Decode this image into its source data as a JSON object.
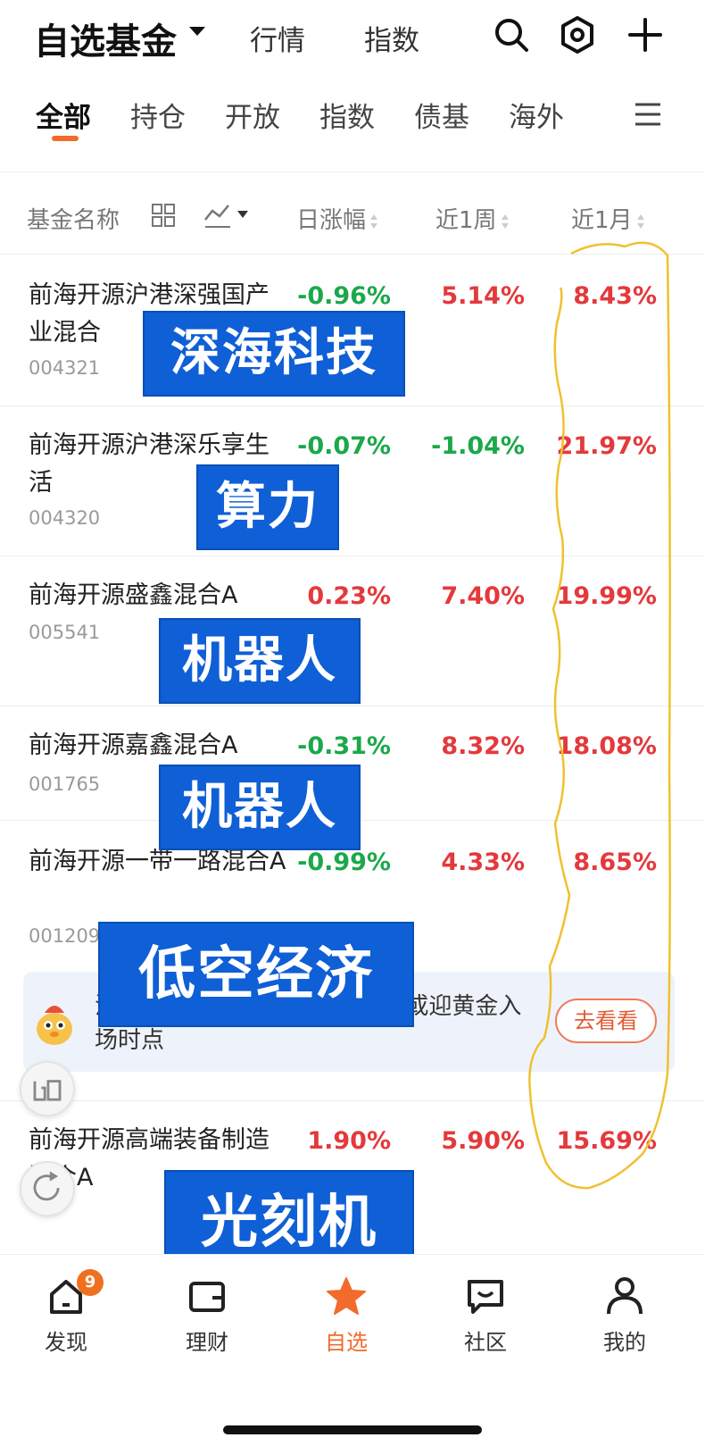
{
  "header": {
    "title": "自选基金",
    "links": [
      "行情",
      "指数"
    ]
  },
  "categories": [
    "全部",
    "持仓",
    "开放",
    "指数",
    "债基",
    "海外"
  ],
  "columns": {
    "name": "基金名称",
    "day": "日涨幅",
    "week": "近1周",
    "month": "近1月"
  },
  "funds": [
    {
      "name": "前海开源沪港深强国产业混合",
      "code": "004321",
      "day": "-0.96%",
      "week": "5.14%",
      "month": "8.43%"
    },
    {
      "name": "前海开源沪港深乐享生活",
      "code": "004320",
      "day": "-0.07%",
      "week": "-1.04%",
      "month": "21.97%"
    },
    {
      "name": "前海开源盛鑫混合A",
      "code": "005541",
      "day": "0.23%",
      "week": "7.40%",
      "month": "19.99%"
    },
    {
      "name": "前海开源嘉鑫混合A",
      "code": "001765",
      "day": "-0.31%",
      "week": "8.32%",
      "month": "18.08%"
    },
    {
      "name": "前海开源一带一路混合A",
      "code": "001209",
      "day": "-0.99%",
      "week": "4.33%",
      "month": "8.65%"
    },
    {
      "name": "前海开源高端装备制造混合A",
      "code": "",
      "day": "1.90%",
      "week": "5.90%",
      "month": "15.69%"
    }
  ],
  "overlays": [
    "深海科技",
    "算力",
    "机器人",
    "机器人",
    "低空经济",
    "光刻机"
  ],
  "promo": {
    "text_line1": "洼                                       或迎黄金入",
    "text_line2": "场时点",
    "button": "去看看"
  },
  "bottom_nav": {
    "items": [
      {
        "label": "发现",
        "icon": "home-icon",
        "badge": "9"
      },
      {
        "label": "理财",
        "icon": "wallet-icon"
      },
      {
        "label": "自选",
        "icon": "star-icon"
      },
      {
        "label": "社区",
        "icon": "chat-icon"
      },
      {
        "label": "我的",
        "icon": "profile-icon"
      }
    ]
  },
  "colors": {
    "up": "#e4393c",
    "down": "#1ba84a",
    "accent": "#f26a2c",
    "overlay": "#0f5fd6",
    "annotation": "#f0c030"
  }
}
